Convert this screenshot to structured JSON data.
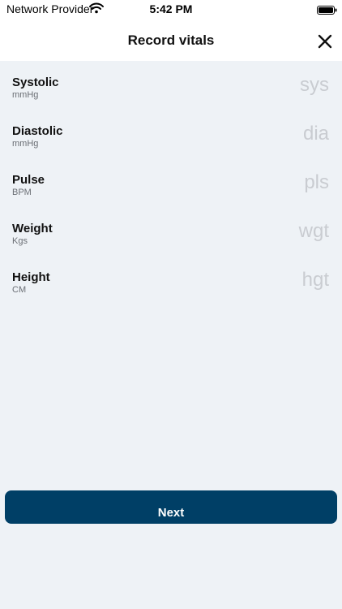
{
  "status_bar": {
    "carrier": "Network Provider",
    "time": "5:42 PM",
    "wifi_icon": "wifi-icon",
    "battery_icon": "battery-full-icon"
  },
  "header": {
    "title": "Record vitals",
    "close_icon": "close-icon"
  },
  "vitals": [
    {
      "label": "Systolic",
      "unit": "mmHg",
      "placeholder": "sys",
      "value": ""
    },
    {
      "label": "Diastolic",
      "unit": "mmHg",
      "placeholder": "dia",
      "value": ""
    },
    {
      "label": "Pulse",
      "unit": "BPM",
      "placeholder": "pls",
      "value": ""
    },
    {
      "label": "Weight",
      "unit": "Kgs",
      "placeholder": "wgt",
      "value": ""
    },
    {
      "label": "Height",
      "unit": "CM",
      "placeholder": "hgt",
      "value": ""
    }
  ],
  "footer": {
    "next_label": "Next"
  },
  "colors": {
    "background": "#eef2f6",
    "primary_button": "#003f66",
    "placeholder": "#c9ccd1"
  }
}
